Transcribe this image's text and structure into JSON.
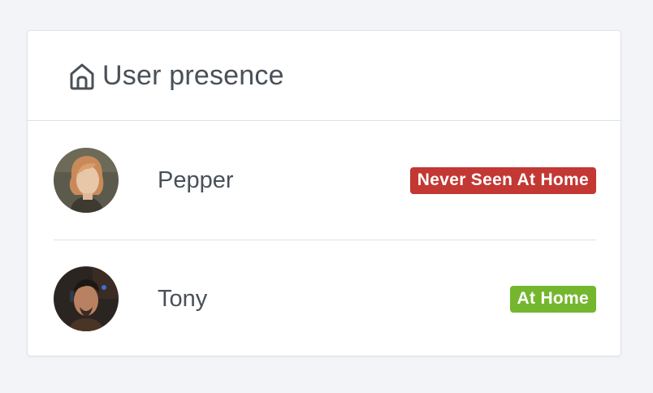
{
  "card": {
    "title": "User presence",
    "header_icon": "home-icon"
  },
  "users": [
    {
      "name": "Pepper",
      "status": "Never Seen At Home",
      "status_color": "#c33833"
    },
    {
      "name": "Tony",
      "status": "At Home",
      "status_color": "#74b72e"
    }
  ]
}
